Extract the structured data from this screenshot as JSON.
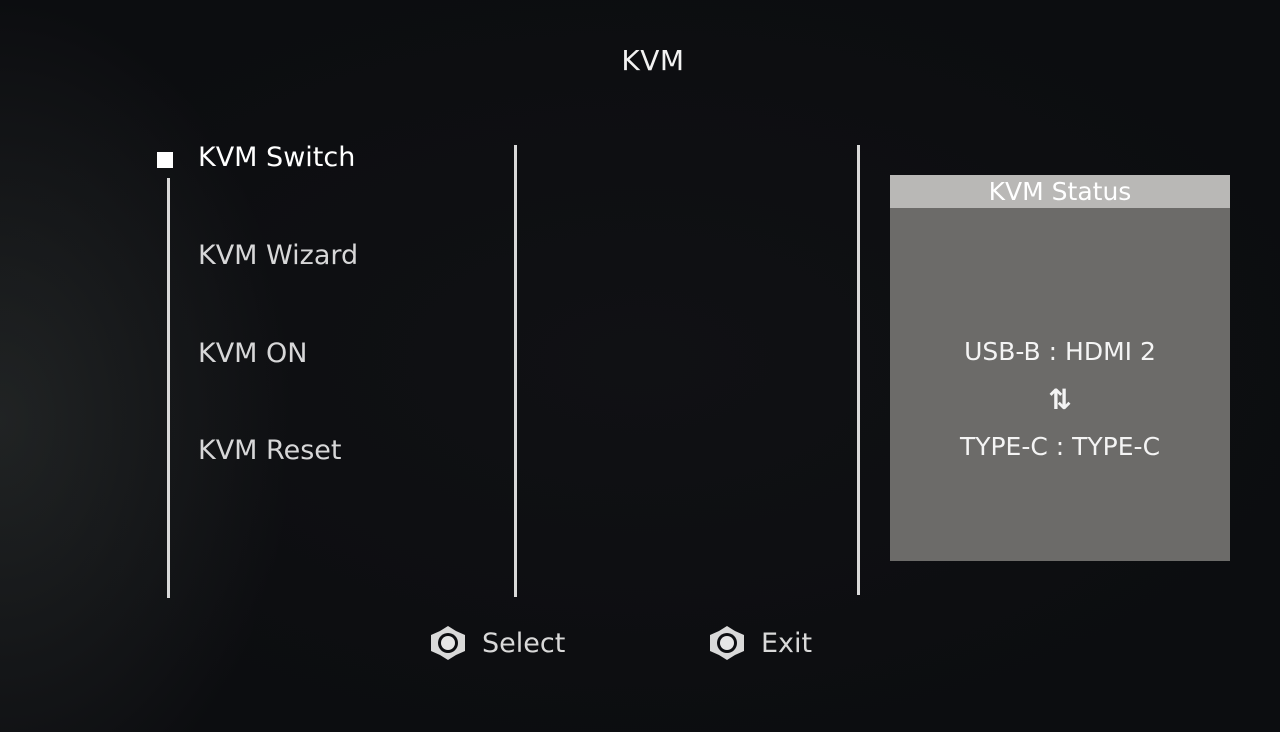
{
  "title": "KVM",
  "menu": {
    "items": [
      {
        "label": "KVM Switch",
        "selected": true
      },
      {
        "label": "KVM Wizard",
        "selected": false
      },
      {
        "label": "KVM ON",
        "selected": false
      },
      {
        "label": "KVM Reset",
        "selected": false
      }
    ]
  },
  "status": {
    "header": "KVM Status",
    "line1": "USB-B : HDMI 2",
    "swap_symbol": "⇅",
    "line2": "TYPE-C : TYPE-C"
  },
  "footer": {
    "select_label": "Select",
    "exit_label": "Exit"
  },
  "icons": {
    "selection_bullet": "square-bullet-icon",
    "joystick": "joystick-icon",
    "swap": "swap-arrows-icon"
  },
  "colors": {
    "background": "#0d0e11",
    "panel": "#6c6b69",
    "panel_header": "#b9b8b6",
    "text": "#e9e9ea"
  }
}
